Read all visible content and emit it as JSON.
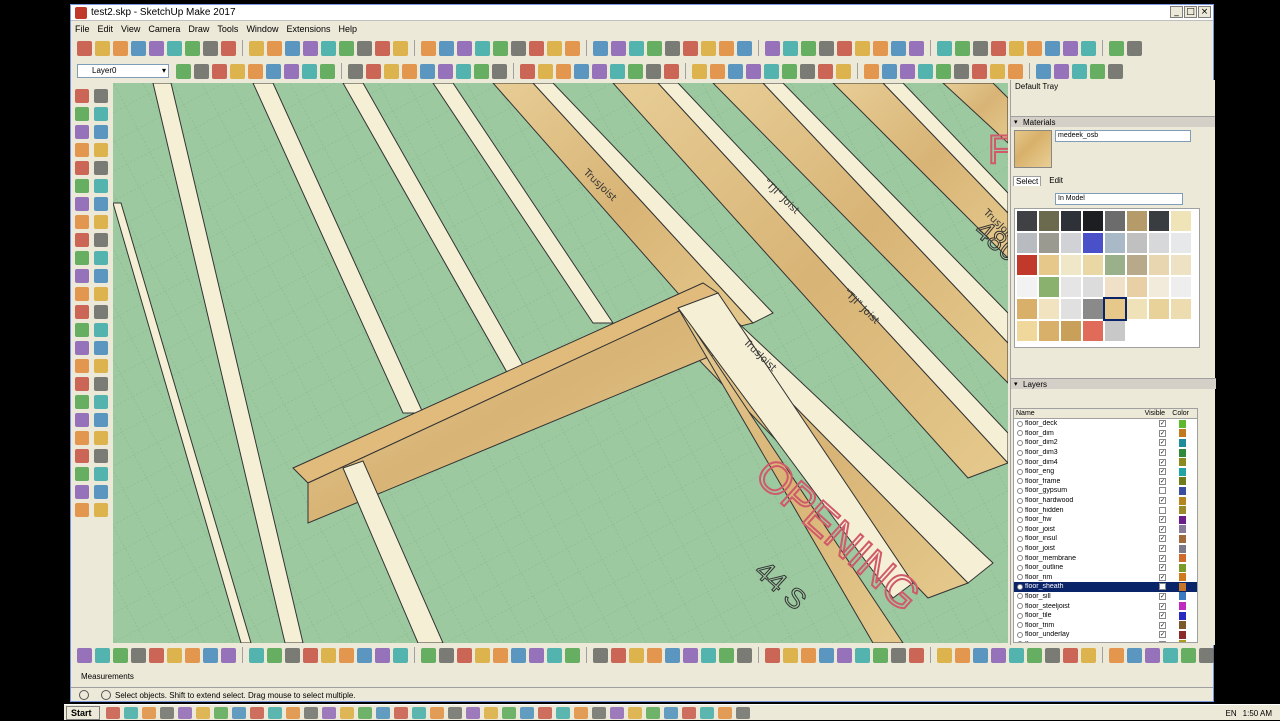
{
  "window": {
    "title": "test2.skp - SketchUp Make 2017",
    "controls": [
      "_",
      "□",
      "×"
    ]
  },
  "menu": [
    "File",
    "Edit",
    "View",
    "Camera",
    "Draw",
    "Tools",
    "Window",
    "Extensions",
    "Help"
  ],
  "layer_toolbar": {
    "current_layer": "Layer0"
  },
  "tray": {
    "title": "Default Tray",
    "materials": {
      "title": "Materials",
      "current_material": "medeek_osb",
      "tabs": [
        "Select",
        "Edit"
      ],
      "collection": "In Model",
      "swatch_colors": [
        "#3f4145",
        "#6b6a4e",
        "#2e3138",
        "#1d1e21",
        "#6c6c6c",
        "#b59a6a",
        "#3a3d40",
        "#efe3b8",
        "#b8bcc0",
        "#9a9a90",
        "#d0d2d6",
        "#4a50c8",
        "#a9b9c8",
        "#c0c0c0",
        "#d6d8da",
        "#e6e8ea",
        "#c0392b",
        "#e6c88a",
        "#f0e6c8",
        "#e9d8a6",
        "#9ab08a",
        "#b8a98a",
        "#e8d6b0",
        "#ede2c4",
        "#f2f2f2",
        "#8bb16f",
        "#e5e5e5",
        "#dcdcdc",
        "#f0e0c8",
        "#e8cfa6",
        "#f2ebdc",
        "#eeeeee",
        "#d8b06a",
        "#f1e2c0",
        "#e0e0e0",
        "#8a8a8a",
        "#e6c88a",
        "#f0e2b8",
        "#e9d29a",
        "#eddcb0",
        "#f0d89c",
        "#d8b06a",
        "#c9a05a",
        "#e06b5a",
        "#c8c8c8"
      ],
      "selected_swatch": 36
    },
    "layers": {
      "title": "Layers",
      "columns": {
        "name": "Name",
        "visible": "Visible",
        "color": "Color"
      },
      "items": [
        {
          "name": "floor_deck",
          "visible": true,
          "color": "#5db82e"
        },
        {
          "name": "floor_dim",
          "visible": true,
          "color": "#c27a1e"
        },
        {
          "name": "floor_dim2",
          "visible": true,
          "color": "#1e8c9a"
        },
        {
          "name": "floor_dim3",
          "visible": true,
          "color": "#2e8a3a"
        },
        {
          "name": "floor_dim4",
          "visible": true,
          "color": "#8a8a1e"
        },
        {
          "name": "floor_eng",
          "visible": true,
          "color": "#22a4a4"
        },
        {
          "name": "floor_frame",
          "visible": true,
          "color": "#6e7c1a"
        },
        {
          "name": "floor_gypsum",
          "visible": false,
          "color": "#3a4ea0"
        },
        {
          "name": "floor_hardwood",
          "visible": true,
          "color": "#b5861e"
        },
        {
          "name": "floor_hidden",
          "visible": false,
          "color": "#9a8a2a"
        },
        {
          "name": "floor_hw",
          "visible": true,
          "color": "#6a1e8a"
        },
        {
          "name": "floor_joist",
          "visible": true,
          "color": "#8a7a9a"
        },
        {
          "name": "floor_insul",
          "visible": true,
          "color": "#a06a3a"
        },
        {
          "name": "floor_joist",
          "visible": true,
          "color": "#7a7a8a"
        },
        {
          "name": "floor_membrane",
          "visible": true,
          "color": "#d06a2a"
        },
        {
          "name": "floor_outline",
          "visible": true,
          "color": "#7a9a2a"
        },
        {
          "name": "floor_rim",
          "visible": true,
          "color": "#d07a1e"
        },
        {
          "name": "floor_sheath",
          "visible": false,
          "color": "#c8762a",
          "selected": true
        },
        {
          "name": "floor_sill",
          "visible": true,
          "color": "#3a7ac0"
        },
        {
          "name": "floor_steeljoist",
          "visible": true,
          "color": "#c02ac0"
        },
        {
          "name": "floor_tile",
          "visible": true,
          "color": "#2a2ac0"
        },
        {
          "name": "floor_trim",
          "visible": true,
          "color": "#7a5a2a"
        },
        {
          "name": "floor_underlay",
          "visible": true,
          "color": "#8a2a2a"
        },
        {
          "name": "floor_wrap",
          "visible": true,
          "color": "#b09a1e"
        }
      ]
    }
  },
  "viewport": {
    "joist_print": "\"TJI\" Joist",
    "joist_brand": "TrusJoist",
    "opening_label": "OPENING",
    "opening_dim": "44 S",
    "corner_label_1": "F",
    "corner_label_2": "480"
  },
  "measurements_label": "Measurements",
  "status_text": "Select objects. Shift to extend select. Drag mouse to select multiple.",
  "taskbar": {
    "start": "Start",
    "lang": "EN",
    "clock": "1:50 AM"
  },
  "accent": "#0a246a"
}
